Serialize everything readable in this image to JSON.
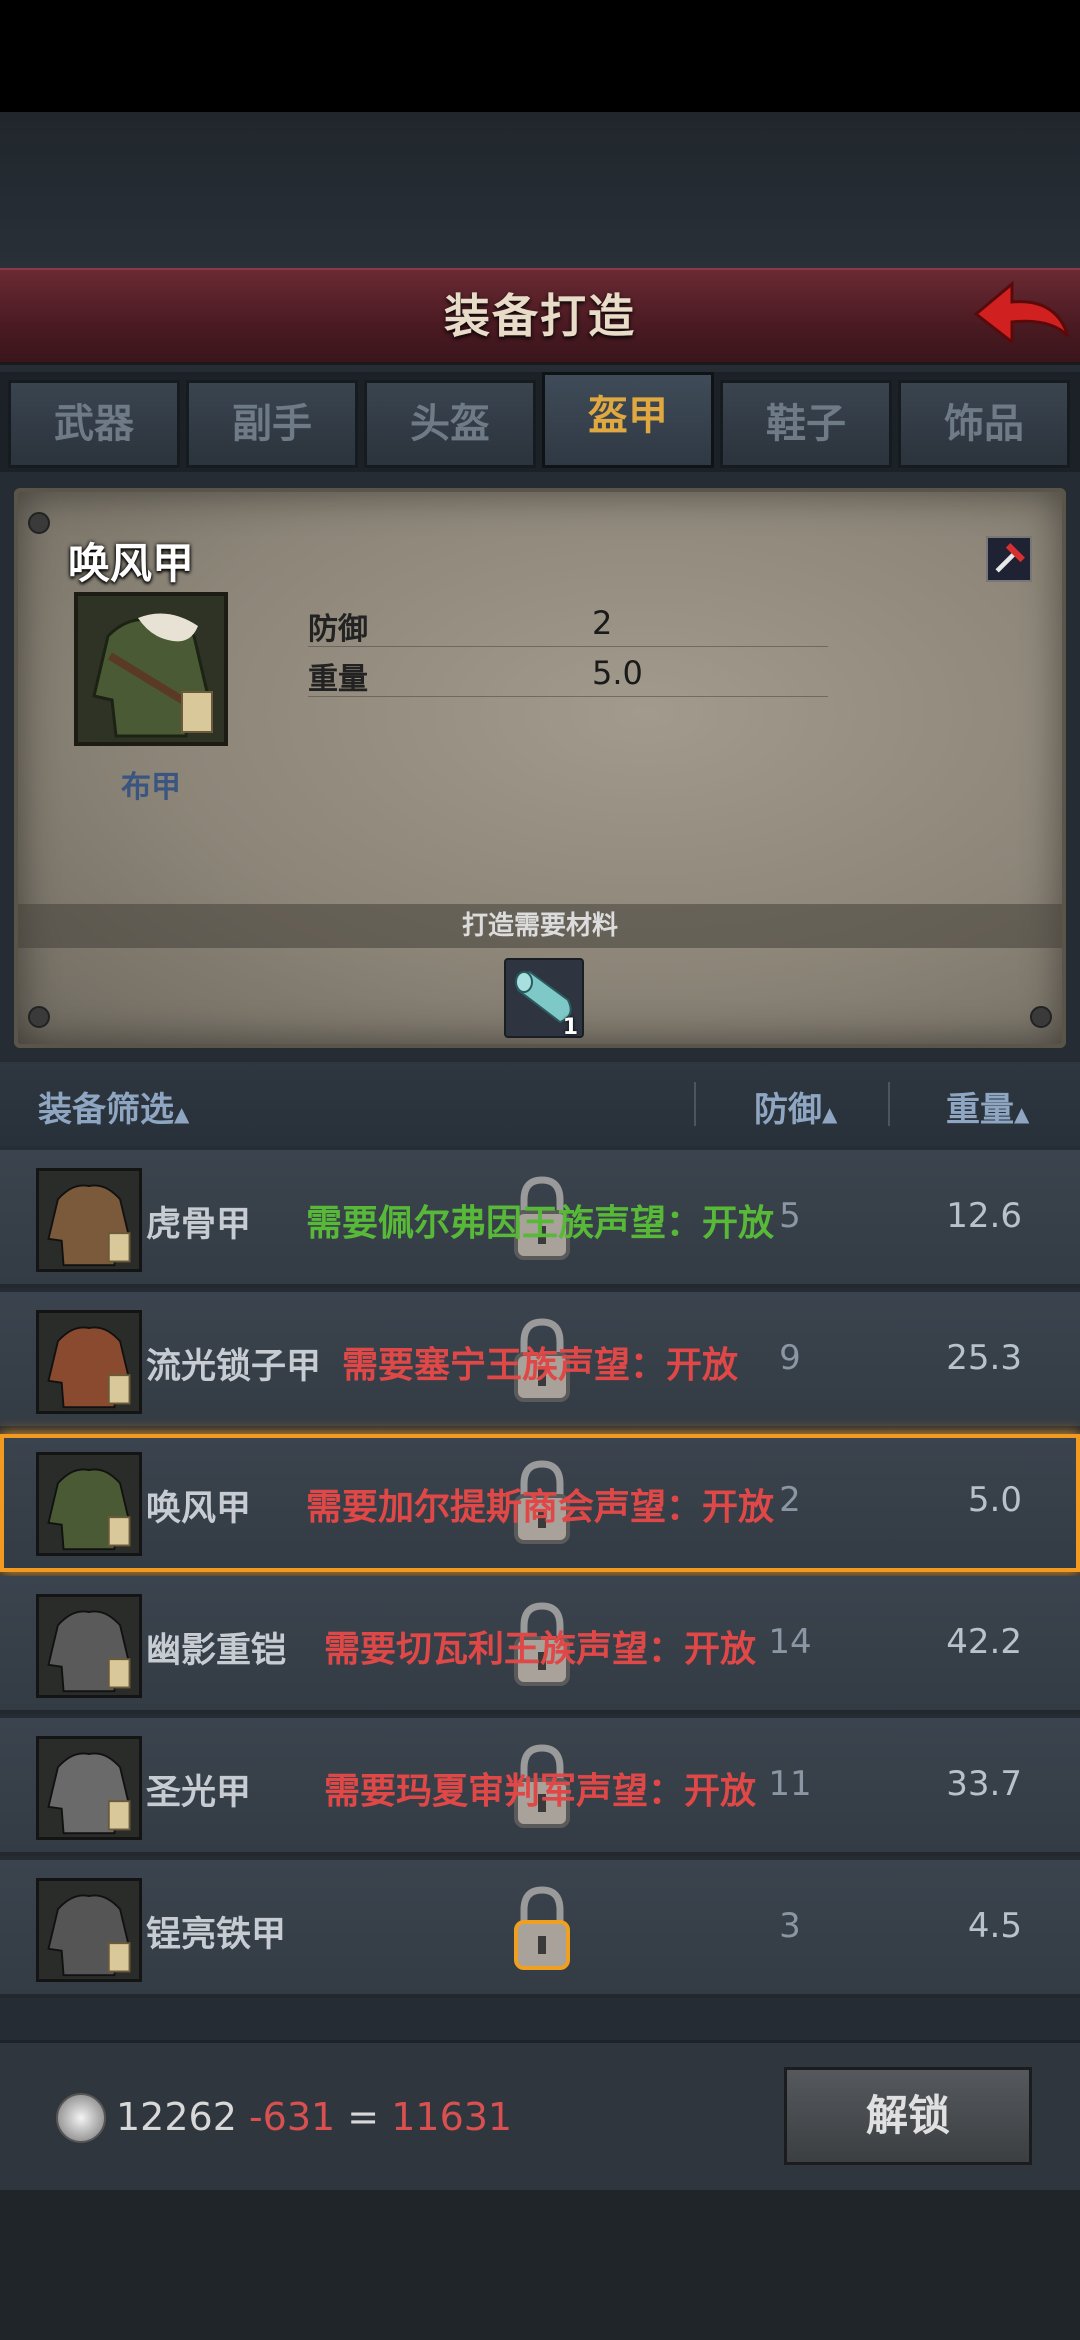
{
  "header": {
    "title": "装备打造"
  },
  "tabs": [
    {
      "label": "武器",
      "active": false
    },
    {
      "label": "副手",
      "active": false
    },
    {
      "label": "头盔",
      "active": false
    },
    {
      "label": "盔甲",
      "active": true
    },
    {
      "label": "鞋子",
      "active": false
    },
    {
      "label": "饰品",
      "active": false
    }
  ],
  "detail": {
    "name": "唤风甲",
    "type": "布甲",
    "stats": [
      {
        "label": "防御",
        "value": "2"
      },
      {
        "label": "重量",
        "value": "5.0"
      }
    ],
    "materials_label": "打造需要材料",
    "material": {
      "icon": "cloth-roll-icon",
      "count": "1"
    }
  },
  "filter": {
    "label": "装备筛选",
    "defense": "防御",
    "weight": "重量",
    "sort_arrow": "▲"
  },
  "items": [
    {
      "name": "虎骨甲",
      "req": "需要佩尔弗因王族声望：开放",
      "req_color": "#58b838",
      "defense": "5",
      "weight": "12.6",
      "selected": false,
      "icon_color": "#7a5a3a"
    },
    {
      "name": "流光锁子甲",
      "req": "需要塞宁王族声望：开放",
      "req_color": "#e04848",
      "defense": "9",
      "weight": "25.3",
      "selected": false,
      "icon_color": "#8a4a30"
    },
    {
      "name": "唤风甲",
      "req": "需要加尔提斯商会声望：开放",
      "req_color": "#e04848",
      "defense": "2",
      "weight": "5.0",
      "selected": true,
      "icon_color": "#4a5a34"
    },
    {
      "name": "幽影重铠",
      "req": "需要切瓦利王族声望：开放",
      "req_color": "#e04848",
      "defense": "14",
      "weight": "42.2",
      "selected": false,
      "icon_color": "#5a5a5a"
    },
    {
      "name": "圣光甲",
      "req": "需要玛夏审判军声望：开放",
      "req_color": "#e04848",
      "defense": "11",
      "weight": "33.7",
      "selected": false,
      "icon_color": "#6a6a6a"
    },
    {
      "name": "锃亮铁甲",
      "req": "",
      "req_color": "#e04848",
      "defense": "3",
      "weight": "4.5",
      "selected": false,
      "icon_color": "#555555"
    }
  ],
  "footer": {
    "balance": "12262",
    "cost": " -631 ",
    "equals": "=",
    "result": " 11631",
    "unlock_label": "解锁",
    "cost_color": "#d85050"
  }
}
